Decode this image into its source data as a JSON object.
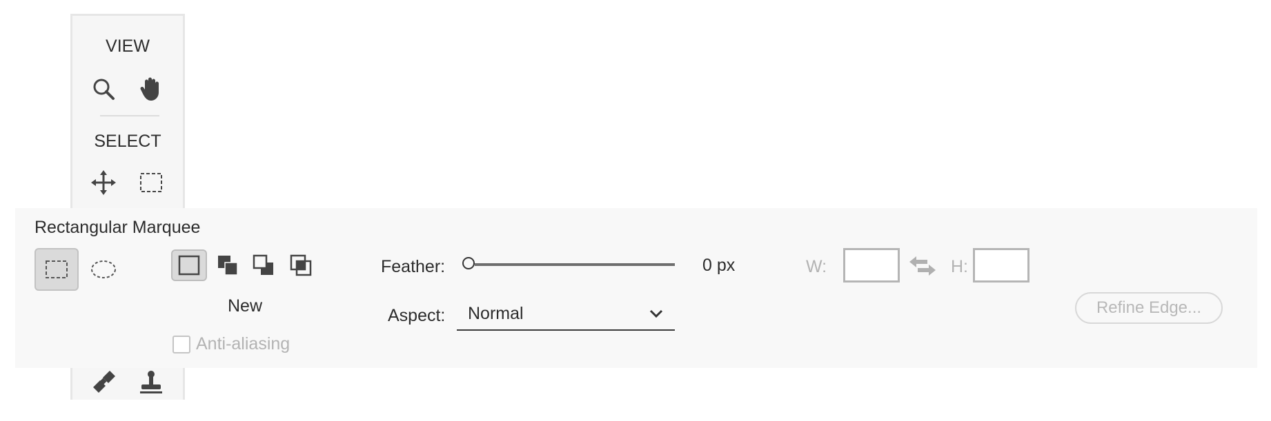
{
  "toolbox": {
    "view_heading": "VIEW",
    "select_heading": "SELECT",
    "icons": {
      "zoom": "magnifier-icon",
      "hand": "hand-icon",
      "move": "move-icon",
      "marquee": "rectangular-marquee-icon",
      "brush": "healing-brush-icon",
      "stamp": "clone-stamp-icon"
    }
  },
  "options": {
    "title": "Rectangular Marquee",
    "tools": [
      {
        "name": "rectangular-marquee",
        "active": true
      },
      {
        "name": "elliptical-marquee",
        "active": false
      }
    ],
    "selection_modes": [
      {
        "name": "new-selection",
        "active": true
      },
      {
        "name": "add-to-selection",
        "active": false
      },
      {
        "name": "subtract-from-selection",
        "active": false
      },
      {
        "name": "intersect-with-selection",
        "active": false
      }
    ],
    "mode_label": "New",
    "anti_aliasing_label": "Anti-aliasing",
    "anti_aliasing_checked": false,
    "feather_label": "Feather:",
    "feather_value": "0 px",
    "feather_fraction": 0,
    "aspect_label": "Aspect:",
    "aspect_value": "Normal",
    "width_label": "W:",
    "height_label": "H:",
    "width_value": "",
    "height_value": "",
    "refine_edge_label": "Refine Edge..."
  }
}
